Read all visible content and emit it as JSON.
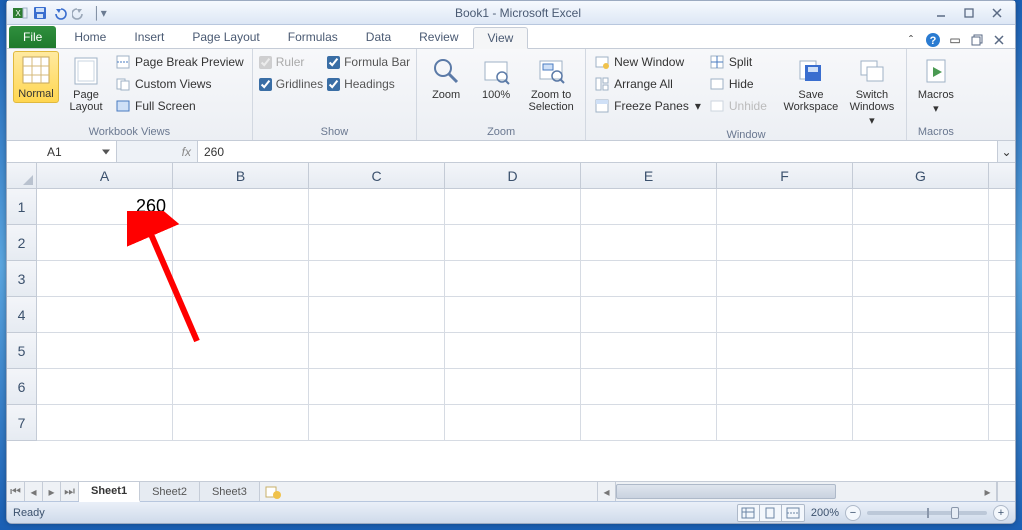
{
  "window": {
    "title": "Book1  -  Microsoft Excel"
  },
  "tabs": {
    "file": "File",
    "items": [
      "Home",
      "Insert",
      "Page Layout",
      "Formulas",
      "Data",
      "Review",
      "View"
    ],
    "active": "View"
  },
  "ribbon": {
    "workbook_views": {
      "label": "Workbook Views",
      "normal": "Normal",
      "page_layout": "Page\nLayout",
      "page_break": "Page Break Preview",
      "custom_views": "Custom Views",
      "full_screen": "Full Screen"
    },
    "show": {
      "label": "Show",
      "ruler": "Ruler",
      "gridlines": "Gridlines",
      "formula_bar": "Formula Bar",
      "headings": "Headings"
    },
    "zoom": {
      "label": "Zoom",
      "zoom": "Zoom",
      "hundred": "100%",
      "to_selection": "Zoom to\nSelection"
    },
    "window_grp": {
      "label": "Window",
      "new_window": "New Window",
      "arrange_all": "Arrange All",
      "freeze_panes": "Freeze Panes",
      "split": "Split",
      "hide": "Hide",
      "unhide": "Unhide",
      "save_workspace": "Save\nWorkspace",
      "switch_windows": "Switch\nWindows"
    },
    "macros": {
      "label": "Macros",
      "macros": "Macros"
    }
  },
  "formula_bar": {
    "name_box": "A1",
    "fx": "fx",
    "value": "260"
  },
  "columns": [
    "A",
    "B",
    "C",
    "D",
    "E",
    "F",
    "G"
  ],
  "row_count": 7,
  "cells": {
    "A1": "260"
  },
  "sheet_tabs": [
    "Sheet1",
    "Sheet2",
    "Sheet3"
  ],
  "active_sheet": "Sheet1",
  "status": {
    "ready": "Ready",
    "zoom": "200%"
  }
}
